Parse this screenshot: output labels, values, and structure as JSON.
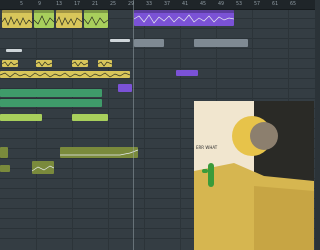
{
  "timeline": {
    "bar_numbers": [
      "5",
      "9",
      "13",
      "17",
      "21",
      "25",
      "29",
      "33",
      "37",
      "41",
      "45",
      "49",
      "53",
      "57",
      "61",
      "65",
      "69",
      "73",
      "77",
      "81",
      "85"
    ]
  },
  "clips": {
    "c1": "",
    "c2": "",
    "c3": "",
    "c4": "",
    "c5": "",
    "c6": "",
    "c7": "",
    "c8": "",
    "c9": "",
    "c10": "",
    "c11": "",
    "c12": "",
    "c13": "",
    "c14": "",
    "c15": "",
    "c16": ""
  },
  "artwork": {
    "caption": "ERR WHAT",
    "colors": {
      "sky": "#f1e6cf",
      "desert": "#d6b650",
      "dune": "#c7a544",
      "sun": "#e7c34a",
      "moon": "#8c7f6e",
      "cactus": "#3a9b3a"
    }
  },
  "colors": {
    "background": "#313a40",
    "yellow_clip": "#d8c65a",
    "green_clip": "#3f9b6a",
    "violet_clip": "#7b52d6"
  }
}
